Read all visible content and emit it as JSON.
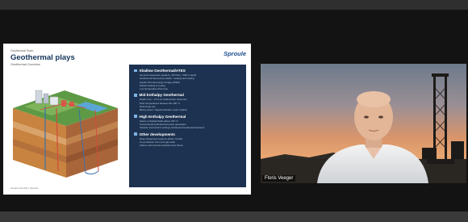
{
  "slide": {
    "kicker": "Geothermal Team",
    "title": "Geothermal plays",
    "subtitle": "Geothermal Overview",
    "logo": "Sproule",
    "footer": "Geothermal 101 | Sproule",
    "sections": [
      {
        "title": "Shallow Geothermal/ATES",
        "lines": [
          "Ground temperature gradient ~30°C/km; <500 m depth",
          "Geothermal heat pumps (GHP) - heating and cooling",
          "Aquifer thermal energy storage (ATES)",
          "District heating & cooling",
          "Low temperature direct use"
        ]
      },
      {
        "title": "Mid Enthalpy Geothermal",
        "lines": [
          "Depth 1 km – 3 km for sedimentary reservoirs",
          "Fluid temperatures between 60–150 °C",
          "Direct heat use",
          "Binary power: Organic Rankine Cycle / Kalina"
        ]
      },
      {
        "title": "High Enthalpy Geothermal",
        "lines": [
          "Steam or flashed fluids above 150 °C",
          "Conventional hydrothermal power generation",
          "Volcanic and tectonic settings, Enhanced Geothermal Systems"
        ]
      },
      {
        "title": "Other developments",
        "lines": [
          "Deep closed-loop systems (AGS / CLGS)",
          "Co-production from oil & gas wells",
          "Lithium and mineral extraction from brines"
        ]
      }
    ]
  },
  "participant": {
    "name": "Floris Veeger"
  },
  "colors": {
    "panel": "#1c3250",
    "title": "#12345a",
    "logo": "#1d4f8f"
  }
}
